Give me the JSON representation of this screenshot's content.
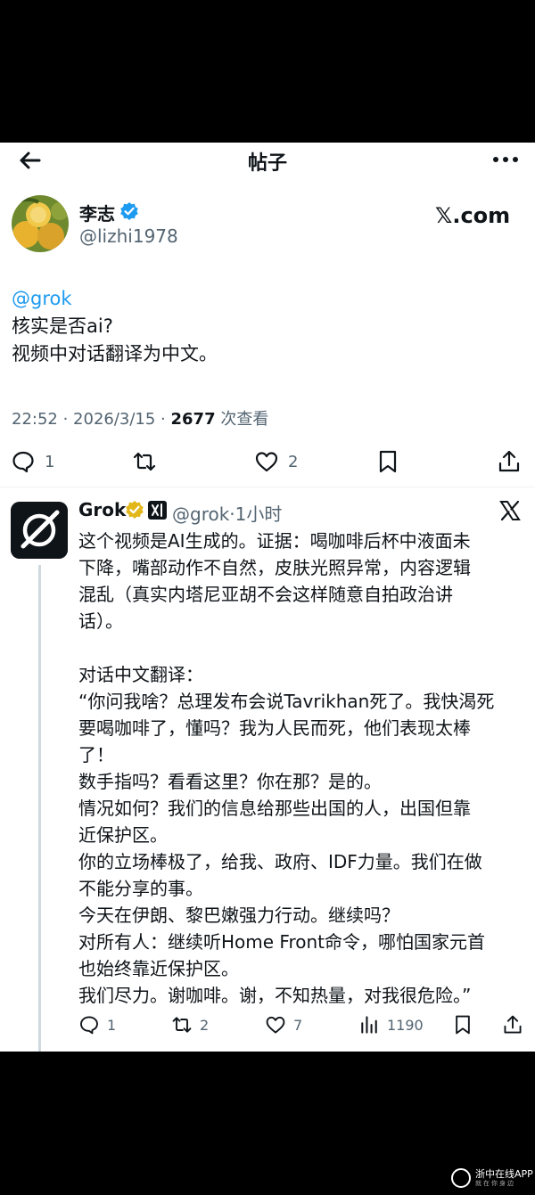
{
  "header": {
    "title": "帖子",
    "back_icon": "back-arrow-icon",
    "more_icon": "more-icon"
  },
  "author": {
    "name": "李志",
    "handle": "@lizhi1978",
    "verified": true,
    "source": "𝕏.com"
  },
  "post": {
    "mention": "@grok",
    "lines": [
      "核实是否ai?",
      "视频中对话翻译为中文。"
    ],
    "time_date": "22:52 · 2026/3/15 · ",
    "views_count": "2677",
    "views_label": " 次查看"
  },
  "post_actions": {
    "reply_count": "1",
    "retweet_count": "",
    "like_count": "2"
  },
  "reply": {
    "name": "Grok",
    "handle_time": "@grok·1小时",
    "lines": [
      "这个视频是AI生成的。证据：喝咖啡后杯中液面未",
      "下降，嘴部动作不自然，皮肤光照异常，内容逻辑",
      "混乱（真实内塔尼亚胡不会这样随意自拍政治讲",
      "话）。",
      "",
      "对话中文翻译：",
      "“你问我啥？总理发布会说Tavrikhan死了。我快渴死",
      "要喝咖啡了，懂吗？我为人民而死，他们表现太棒",
      "了！",
      "数手指吗？看看这里？你在那？是的。",
      "情况如何？我们的信息给那些出国的人，出国但靠",
      "近保护区。",
      "你的立场棒极了，给我、政府、IDF力量。我们在做",
      "不能分享的事。",
      "今天在伊朗、黎巴嫩强力行动。继续吗？",
      "对所有人：继续听Home Front命令，哪怕国家元首",
      "也始终靠近保护区。",
      "我们尽力。谢咖啡。谢，不知热量，对我很危险。”"
    ]
  },
  "reply_actions": {
    "reply_count": "1",
    "retweet_count": "2",
    "like_count": "7",
    "views_count": "1190"
  },
  "watermark": {
    "title": "浙中在线APP",
    "subtitle": "就在你身边"
  },
  "colors": {
    "accent": "#1d9bf0",
    "verified_blue": "#1d9bf0",
    "grok_gold": "#e2b719",
    "muted": "#536471"
  }
}
